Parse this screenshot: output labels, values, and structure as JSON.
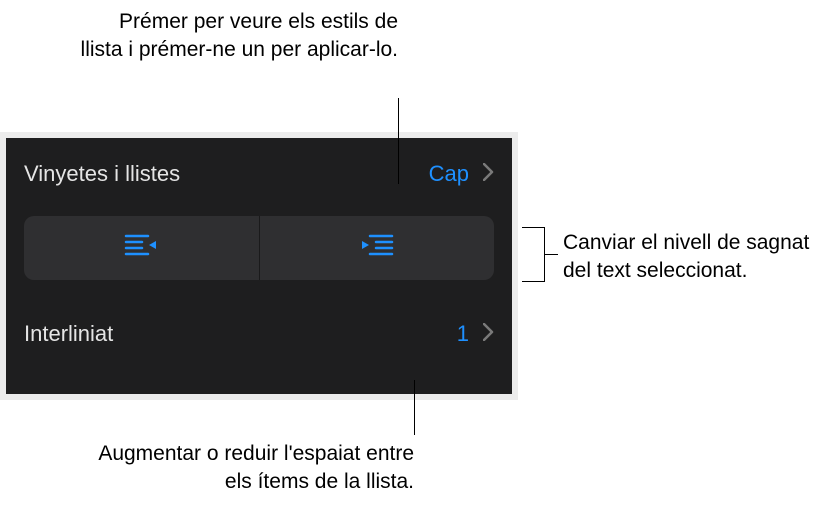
{
  "panel": {
    "bulletsLists": {
      "label": "Vinyetes i llistes",
      "value": "Cap"
    },
    "lineSpacing": {
      "label": "Interliniat",
      "value": "1"
    }
  },
  "callouts": {
    "top": "Prémer per veure els estils de llista i prémer-ne un per aplicar-lo.",
    "right": "Canviar el nivell de sagnat del text seleccionat.",
    "bottom": "Augmentar o reduir l'espaiat entre els ítems de la llista."
  }
}
